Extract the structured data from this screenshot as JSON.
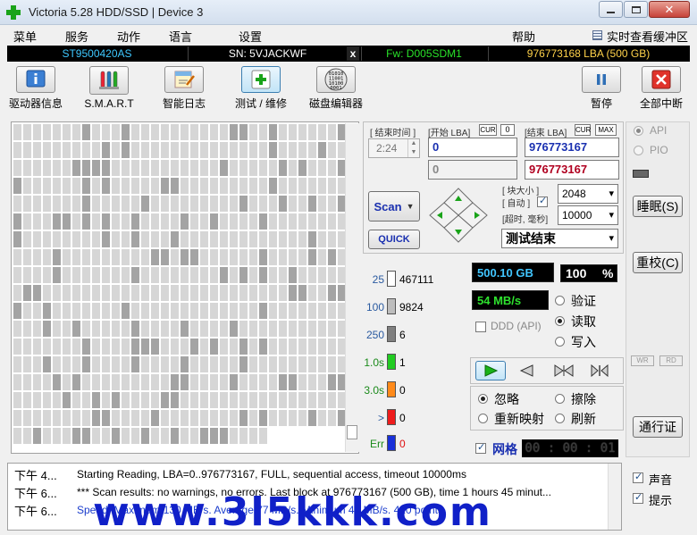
{
  "window": {
    "title": "Victoria 5.28 HDD/SSD | Device 3",
    "close_glyph": "✕"
  },
  "menu": {
    "items": [
      "菜单",
      "服务",
      "动作",
      "语言",
      "设置",
      "帮助"
    ],
    "cache_toggle": "实时查看缓冲区"
  },
  "drive": {
    "model": "ST9500420AS",
    "serial": "SN: 5VJACKWF",
    "close": "x",
    "firmware": "Fw: D005SDM1",
    "capacity": "976773168 LBA (500 GB)",
    "colors": {
      "model": "#3ec8ff",
      "serial": "#ffffff",
      "firmware": "#29e229",
      "capacity": "#ffd24a"
    }
  },
  "toolbar": {
    "driver_info": {
      "label": "驱动器信息",
      "icon": "info-icon"
    },
    "smart": {
      "label": "S.M.A.R.T",
      "icon": "test-tubes-icon"
    },
    "smart_log": {
      "label": "智能日志",
      "icon": "log-icon"
    },
    "test": {
      "label": "测试 / 维修",
      "icon": "plus-icon"
    },
    "disk_editor": {
      "label": "磁盘编辑器",
      "icon": "binary-icon"
    },
    "pause": {
      "label": "暂停",
      "icon": "pause-icon"
    },
    "stop_all": {
      "label": "全部中断",
      "icon": "close-icon"
    }
  },
  "scan": {
    "end_time_label": "[ 结束时间 ]",
    "end_time": "2:24",
    "start_lba_label": "[开始 LBA]",
    "cur_badge": "CUR",
    "zero_badge": "0",
    "start_lba": "0",
    "start_lba_current": "0",
    "end_lba_label": "[结束 LBA]",
    "max_badge": "MAX",
    "end_lba": "976773167",
    "end_lba_current": "976773167",
    "block_size_label": "[ 块大小 ]",
    "auto_label": "[ 自动 ]",
    "block_size": "2048",
    "timeout_label": "[超时, 毫秒]",
    "timeout": "10000",
    "scan_button": "Scan",
    "quick_button": "QUICK",
    "status": "测试结束"
  },
  "stats": [
    {
      "label": "25",
      "count": "467111",
      "color": "#ffffff",
      "label_color": "#2a5aa0"
    },
    {
      "label": "100",
      "count": "9824",
      "color": "#bdbdbd",
      "label_color": "#2a5aa0"
    },
    {
      "label": "250",
      "count": "6",
      "color": "#7f7f7f",
      "label_color": "#2a5aa0"
    },
    {
      "label": "1.0s",
      "count": "1",
      "color": "#22cc22",
      "label_color": "#1a8a1a"
    },
    {
      "label": "3.0s",
      "count": "0",
      "color": "#ff8a1a",
      "label_color": "#1a8a1a"
    },
    {
      "label": ">",
      "count": "0",
      "color": "#ee1c1c",
      "label_color": "#2a5aa0"
    },
    {
      "label": "Err",
      "count": "0",
      "color": "#1830d8",
      "label_color": "#1a8a1a"
    }
  ],
  "readout": {
    "size": "500.10 GB",
    "percent": "100",
    "percent_unit": "%",
    "speed": "54 MB/s",
    "ddd": "DDD (API)"
  },
  "mode": {
    "verify": "验证",
    "read": "读取",
    "write": "写入",
    "selected": "读取"
  },
  "action": {
    "ignore": "忽略",
    "erase": "擦除",
    "remap": "重新映射",
    "refresh": "刷新",
    "selected": "忽略"
  },
  "grid_label": "网格",
  "grid_timer": "00 : 00 : 01",
  "interface": {
    "api": "API",
    "pio": "PIO"
  },
  "side_buttons": {
    "sleep": "睡眠(S)",
    "recalibrate": "重校(C)",
    "pass": "通行证"
  },
  "wr_badges": [
    "WR",
    "RD"
  ],
  "sound": {
    "sound_label": "声音",
    "tips_label": "提示"
  },
  "log": [
    {
      "time": "下午 4...",
      "text": "Starting Reading, LBA=0..976773167, FULL, sequential access, timeout 10000ms",
      "color": "#000000"
    },
    {
      "time": "下午 6...",
      "text": "*** Scan results: no warnings, no errors. Last block at 976773167 (500 GB), time 1 hours 45 minut...",
      "color": "#000000"
    },
    {
      "time": "下午 6...",
      "text": "Speed: Maximum 130 MB/s. Average 77 MB/s. Minimum 47 MB/s. 420 points.",
      "color": "#1a3ccc"
    }
  ],
  "watermark": "www.3l5kkk.com"
}
